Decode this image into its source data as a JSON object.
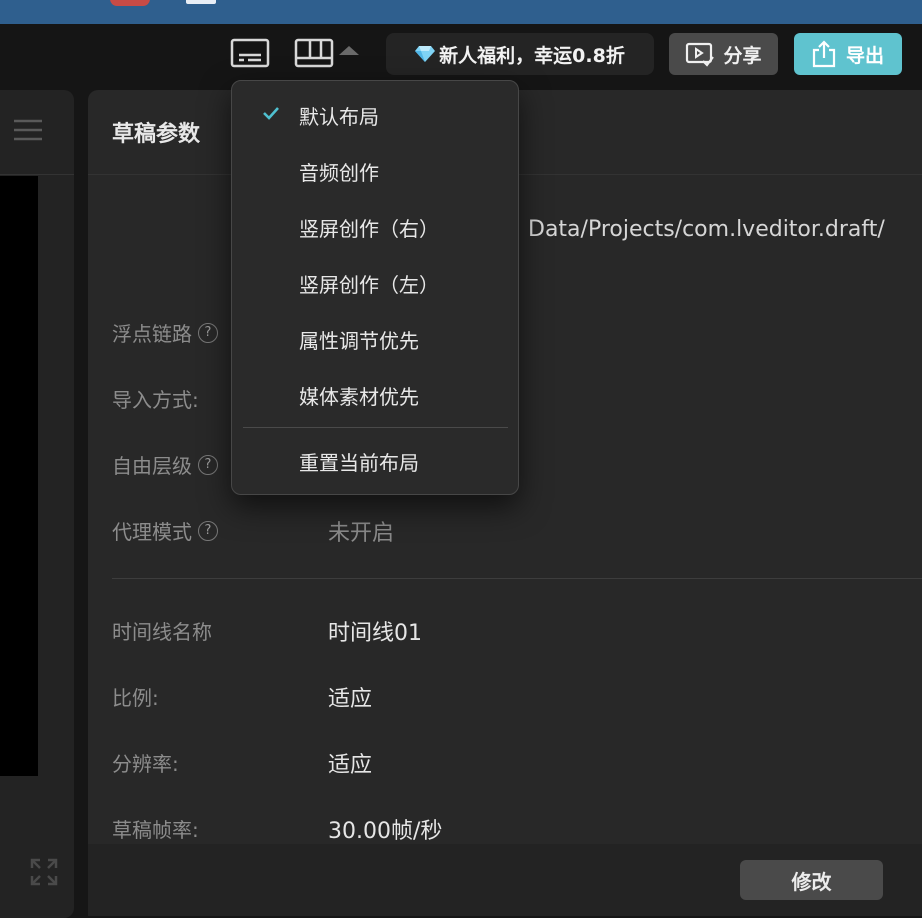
{
  "toolbar": {
    "caption_icon": "caption-icon",
    "layout_icon": "layout-icon",
    "promo_text": "新人福利，幸运0.8折",
    "share_label": "分享",
    "export_label": "导出"
  },
  "layout_menu": {
    "items": [
      {
        "label": "默认布局",
        "checked": true
      },
      {
        "label": "音频创作",
        "checked": false
      },
      {
        "label": "竖屏创作（右）",
        "checked": false
      },
      {
        "label": "竖屏创作（左）",
        "checked": false
      },
      {
        "label": "属性调节优先",
        "checked": false
      },
      {
        "label": "媒体素材优先",
        "checked": false
      }
    ],
    "reset_label": "重置当前布局"
  },
  "draft_panel": {
    "title": "草稿参数",
    "path_fragment": "Data/Projects/com.lveditor.draft/",
    "rows_top": [
      {
        "label": "浮点链路",
        "help": true,
        "value": ""
      },
      {
        "label": "导入方式:",
        "help": false,
        "value": ""
      },
      {
        "label": "自由层级",
        "help": true,
        "value": ""
      },
      {
        "label": "代理模式",
        "help": true,
        "value": "未开启"
      }
    ],
    "rows_bottom": [
      {
        "label": "时间线名称",
        "value": "时间线01"
      },
      {
        "label": "比例:",
        "value": "适应"
      },
      {
        "label": "分辨率:",
        "value": "适应"
      },
      {
        "label": "草稿帧率:",
        "value": "30.00帧/秒"
      }
    ],
    "modify_label": "修改"
  },
  "colors": {
    "accent": "#5fc3cf",
    "check": "#4fc0d0",
    "panel": "#282828",
    "background": "#161616"
  }
}
